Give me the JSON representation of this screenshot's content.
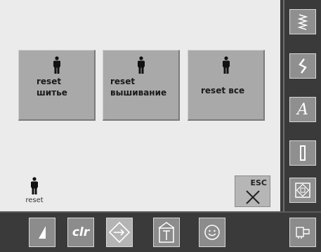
{
  "options": [
    {
      "line1": "reset",
      "line2": "шитье"
    },
    {
      "line1": "reset",
      "line2": "вышивание"
    },
    {
      "line1": "reset все",
      "line2": ""
    }
  ],
  "indicator_label": "reset",
  "esc_label": "ESC",
  "sidebar": {
    "items": [
      "stitch-selection-icon",
      "zigzag-icon",
      "alphabet-icon",
      "buttonhole-icon",
      "quilt-icon"
    ],
    "a_label": "A"
  },
  "bottom": {
    "clr_label": "clr",
    "items": [
      "needle-position-icon",
      "clear-button",
      "setup-icon",
      "tutorial-icon",
      "smiley-icon"
    ],
    "home_icon": "home-icon"
  }
}
